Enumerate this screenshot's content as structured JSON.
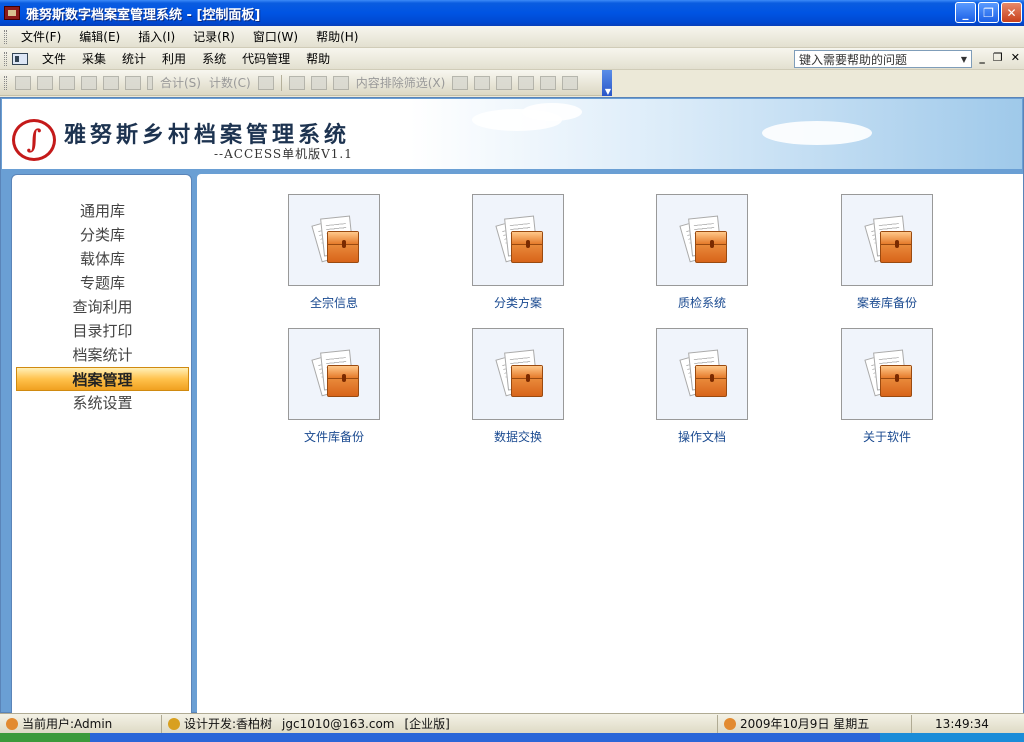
{
  "window": {
    "title": "雅努斯数字档案室管理系统 - [控制面板]"
  },
  "menubar1": [
    "文件(F)",
    "编辑(E)",
    "插入(I)",
    "记录(R)",
    "窗口(W)",
    "帮助(H)"
  ],
  "menubar2": [
    "文件",
    "采集",
    "统计",
    "利用",
    "系统",
    "代码管理",
    "帮助"
  ],
  "help_box": {
    "placeholder": "键入需要帮助的问题"
  },
  "toolbar": {
    "sum_label": "合计(S)",
    "count_label": "计数(C)",
    "filter_label": "内容排除筛选(X)"
  },
  "banner": {
    "app_name": "雅努斯乡村档案管理系统",
    "version": "--ACCESS单机版V1.1"
  },
  "nav": {
    "items": [
      {
        "label": "通用库"
      },
      {
        "label": "分类库"
      },
      {
        "label": "载体库"
      },
      {
        "label": "专题库"
      },
      {
        "label": "查询利用"
      },
      {
        "label": "目录打印"
      },
      {
        "label": "档案统计"
      },
      {
        "label": "档案管理"
      },
      {
        "label": "系统设置"
      }
    ],
    "active": "档案管理"
  },
  "tiles": [
    {
      "label": "全宗信息"
    },
    {
      "label": "分类方案"
    },
    {
      "label": "质检系统"
    },
    {
      "label": "案卷库备份"
    },
    {
      "label": "文件库备份"
    },
    {
      "label": "数据交换"
    },
    {
      "label": "操作文档"
    },
    {
      "label": "关于软件"
    }
  ],
  "status": {
    "user": "当前用户:Admin",
    "developer": "设计开发:香柏树",
    "email": "jgc1010@163.com",
    "edition": "[企业版]",
    "date": "2009年10月9日 星期五",
    "time": "13:49:34"
  },
  "colors": {
    "titlebar": "#0054e3",
    "nav_active": "#ffc24c",
    "frame": "#6a9fd4",
    "tile_label": "#1a4a90"
  }
}
